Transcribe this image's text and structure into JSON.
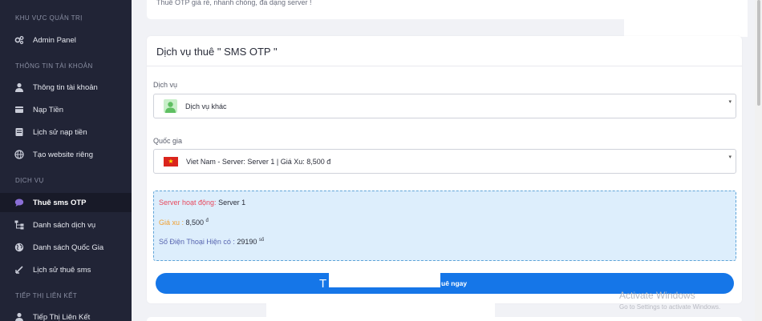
{
  "sidebar": {
    "sections": [
      {
        "title": "KHU VỰC QUẢN TRỊ"
      },
      {
        "title": "THÔNG TIN TÀI KHOẢN"
      },
      {
        "title": "DỊCH VỤ"
      },
      {
        "title": "TIẾP THỊ LIÊN KẾT"
      }
    ],
    "items": [
      {
        "label": "Admin Panel",
        "icon": "cogs-icon"
      },
      {
        "label": "Thông tin tài khoản",
        "icon": "user-icon"
      },
      {
        "label": "Nạp Tiền",
        "icon": "wallet-icon"
      },
      {
        "label": "Lịch sử nạp tiền",
        "icon": "history-icon"
      },
      {
        "label": "Tạo website riêng",
        "icon": "globe-icon"
      },
      {
        "label": "Thuê sms OTP",
        "icon": "comment-icon"
      },
      {
        "label": "Danh sách dịch vụ",
        "icon": "sitemap-icon"
      },
      {
        "label": "Danh sách Quốc Gia",
        "icon": "earth-icon"
      },
      {
        "label": "Lịch sử thuê sms",
        "icon": "history-icon"
      },
      {
        "label": "Tiếp Thị Liên Kết",
        "icon": "user-icon"
      }
    ]
  },
  "top_card": {
    "text": "Thuê OTP giá rẻ, nhanh chóng, đa dạng server !"
  },
  "main": {
    "title": "Dịch vụ thuê \" SMS OTP \"",
    "service_label": "Dịch vụ",
    "service_value": "Dịch vụ khác",
    "country_label": "Quốc gia",
    "country_value": "Viet Nam - Server: Server 1 | Giá Xu: 8,500 đ",
    "info": {
      "server_key": "Server hoạt động:",
      "server_val": " Server 1",
      "price_key": "Giá xu :",
      "price_val": " 8,500 ",
      "price_unit": "đ",
      "phones_key": "Số Điện Thoại Hiện có :",
      "phones_val": " 29190 ",
      "phones_unit": "số"
    },
    "button_prefix": "T",
    "button_suffix": "uê ngay"
  },
  "watermark": {
    "line1": "Activate Windows",
    "line2": "Go to Settings to activate Windows."
  },
  "colors": {
    "accent": "#1576e8",
    "sidebar_bg": "#212436",
    "info_bg": "#ddeefc"
  }
}
